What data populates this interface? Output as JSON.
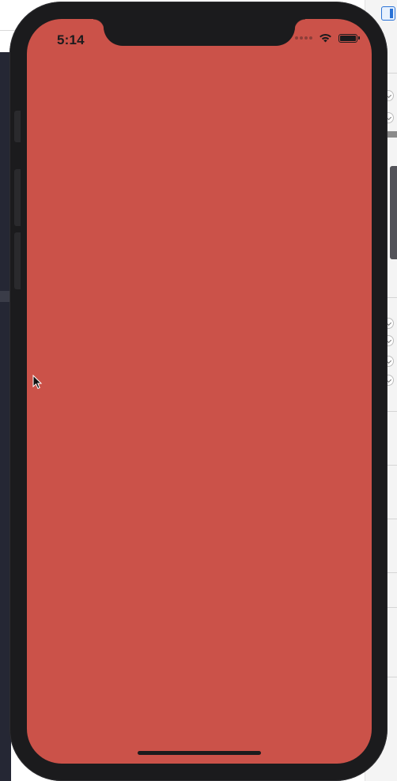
{
  "status_bar": {
    "time": "5:14",
    "icons": [
      "signal-dots-icon",
      "wifi-icon",
      "battery-icon"
    ]
  },
  "screen": {
    "background_color": "#cb5249"
  },
  "colors": {
    "device_frame": "#1b1b1d",
    "screen_background": "#cb5249",
    "mac_sidebar": "#252734"
  }
}
